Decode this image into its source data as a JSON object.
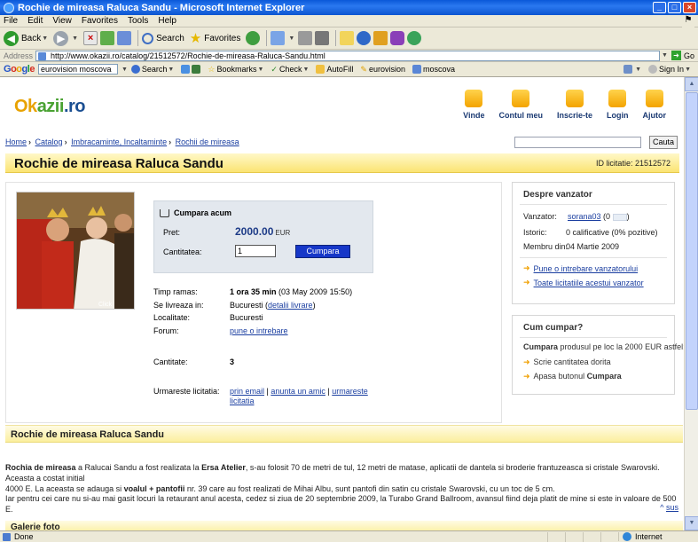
{
  "window": {
    "title": "Rochie de mireasa Raluca Sandu - Microsoft Internet Explorer",
    "controls": [
      "_",
      "□",
      "×"
    ]
  },
  "menubar": {
    "items": [
      "File",
      "Edit",
      "View",
      "Favorites",
      "Tools",
      "Help"
    ]
  },
  "toolbar": {
    "back_label": "Back",
    "search_label": "Search",
    "favorites_label": "Favorites"
  },
  "address": {
    "label": "Address",
    "url": "http://www.okazii.ro/catalog/21512572/Rochie-de-mireasa-Raluca-Sandu.html",
    "go_label": "Go"
  },
  "google_toolbar": {
    "logo": [
      "G",
      "o",
      "o",
      "g",
      "l",
      "e"
    ],
    "query": "eurovision moscova",
    "search_label": "Search",
    "bookmarks_label": "Bookmarks",
    "check_label": "Check",
    "autofill_label": "AutoFill",
    "term1": "eurovision",
    "term2": "moscova",
    "signin_label": "Sign In"
  },
  "site": {
    "logo": {
      "part1": "Ok",
      "part2": "azii",
      "part3": ".ro"
    },
    "nav": [
      {
        "label": "Vinde",
        "icon": "sell-icon"
      },
      {
        "label": "Contul meu",
        "icon": "account-icon"
      },
      {
        "label": "Inscrie-te",
        "icon": "register-icon"
      },
      {
        "label": "Login",
        "icon": "lock-icon"
      },
      {
        "label": "Ajutor",
        "icon": "help-icon"
      }
    ],
    "breadcrumb": [
      "Home",
      "Catalog",
      "Imbracaminte, Incaltaminte",
      "Rochii de mireasa"
    ],
    "search_button": "Cauta"
  },
  "listing": {
    "title": "Rochie de mireasa Raluca Sandu",
    "id_label": "ID licitatie: 21512572",
    "buy": {
      "heading": "Cumpara acum",
      "price_label": "Pret:",
      "price": "2000.00",
      "currency": "EUR",
      "qty_label": "Cantitatea:",
      "qty_value": "1",
      "button": "Cumpara"
    },
    "details": {
      "time_label": "Timp ramas:",
      "time_value": "1 ora 35 min",
      "time_extra": " (03 May 2009 15:50)",
      "delivery_label": "Se livreaza in:",
      "delivery_value": "Bucuresti",
      "delivery_link": "detalii livrare",
      "location_label": "Localitate:",
      "location_value": "Bucuresti",
      "forum_label": "Forum:",
      "forum_link": "pune o intrebare",
      "quantity_label": "Cantitate:",
      "quantity_value": "3",
      "follow_label": "Urmareste licitatia:",
      "follow_link1": "prin email",
      "follow_link2": "anunta un amic",
      "follow_link3": "urmareste",
      "follow_link3b": "licitatia"
    },
    "photo_caption": "Click"
  },
  "seller": {
    "title": "Despre vanzator",
    "seller_label": "Vanzator:",
    "seller_name": "sorana03",
    "seller_extra": "(0",
    "history_label": "Istoric:",
    "history_value": "0 calificative (0% pozitive)",
    "member_label": "Membru din:",
    "member_value": "04 Martie 2009",
    "link1": "Pune o intrebare vanzatorului",
    "link2": "Toate licitatiile acestui vanzator"
  },
  "howto": {
    "title": "Cum cumpar?",
    "intro_bold": "Cumpara",
    "intro_rest": " produsul pe loc la 2000 EUR astfel:",
    "step1": "Scrie cantitatea dorita",
    "step2_pre": "Apasa butonul ",
    "step2_bold": "Cumpara"
  },
  "description": {
    "section_title": "Rochie de mireasa Raluca Sandu",
    "p1_b1": "Rochia de mireasa",
    "p1_t1": " a Ralucai Sandu a fost realizata la ",
    "p1_b2": "Ersa Atelier",
    "p1_t2": ", s-au folosit 70 de metri de tul, 12 metri de matase, aplicatii de dantela si broderie frantuzeasca si cristale Swarovski. Aceasta a costat initial",
    "p1_t3": "4000 E. La aceasta se adauga si ",
    "p1_b3": "voalul + pantofii",
    "p1_t4": " nr. 39 care au fost realizati de Mihai Albu, sunt pantofi din satin cu cristale Swarovski, cu un toc de 5 cm.",
    "p2": "Iar pentru cei care nu si-au mai gasit locuri la retaurant anul acesta, cedez si ziua de 20 septembrie 2009, la Turabo Grand Ballroom, avansul fiind deja platit de mine si este in valoare de 500 E.",
    "top_link": "sus",
    "gallery_title": "Galerie foto"
  },
  "statusbar": {
    "status": "Done",
    "zone": "Internet"
  }
}
